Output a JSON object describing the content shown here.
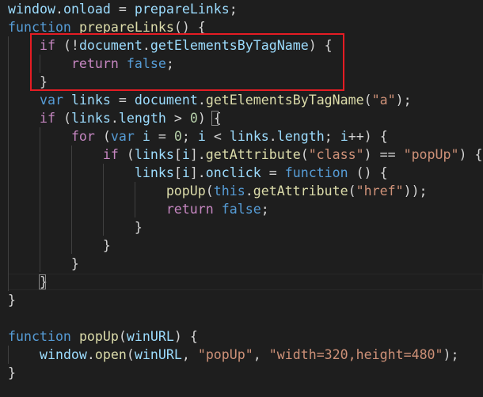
{
  "editor": {
    "highlight_color": "#e51c23",
    "theme": {
      "background": "#1e1e1e",
      "keyword": "#569cd6",
      "control": "#c586c0",
      "function": "#dcdcaa",
      "variable": "#9cdcfe",
      "string": "#ce9178",
      "number": "#b5cea8",
      "plain": "#d4d4d4"
    },
    "lines": [
      [
        [
          "var",
          "window"
        ],
        [
          "pl",
          "."
        ],
        [
          "var",
          "onload"
        ],
        [
          "pl",
          " = "
        ],
        [
          "var",
          "prepareLinks"
        ],
        [
          "pl",
          ";"
        ]
      ],
      [
        [
          "kw",
          "function"
        ],
        [
          "pl",
          " "
        ],
        [
          "fn",
          "prepareLinks"
        ],
        [
          "pl",
          "() {"
        ]
      ],
      [
        [
          "pl",
          "    "
        ],
        [
          "ctl",
          "if"
        ],
        [
          "pl",
          " (!"
        ],
        [
          "var",
          "document"
        ],
        [
          "pl",
          "."
        ],
        [
          "var",
          "getElementsByTagName"
        ],
        [
          "pl",
          ") {"
        ]
      ],
      [
        [
          "pl",
          "        "
        ],
        [
          "ctl",
          "return"
        ],
        [
          "pl",
          " "
        ],
        [
          "kw",
          "false"
        ],
        [
          "pl",
          ";"
        ]
      ],
      [
        [
          "pl",
          "    }"
        ]
      ],
      [
        [
          "pl",
          "    "
        ],
        [
          "kw",
          "var"
        ],
        [
          "pl",
          " "
        ],
        [
          "var",
          "links"
        ],
        [
          "pl",
          " = "
        ],
        [
          "var",
          "document"
        ],
        [
          "pl",
          "."
        ],
        [
          "fn",
          "getElementsByTagName"
        ],
        [
          "pl",
          "("
        ],
        [
          "str",
          "\"a\""
        ],
        [
          "pl",
          ");"
        ]
      ],
      [
        [
          "pl",
          "    "
        ],
        [
          "ctl",
          "if"
        ],
        [
          "pl",
          " ("
        ],
        [
          "var",
          "links"
        ],
        [
          "pl",
          "."
        ],
        [
          "var",
          "length"
        ],
        [
          "pl",
          " > "
        ],
        [
          "num",
          "0"
        ],
        [
          "pl",
          ") {"
        ]
      ],
      [
        [
          "pl",
          "        "
        ],
        [
          "ctl",
          "for"
        ],
        [
          "pl",
          " ("
        ],
        [
          "kw",
          "var"
        ],
        [
          "pl",
          " "
        ],
        [
          "var",
          "i"
        ],
        [
          "pl",
          " = "
        ],
        [
          "num",
          "0"
        ],
        [
          "pl",
          "; "
        ],
        [
          "var",
          "i"
        ],
        [
          "pl",
          " < "
        ],
        [
          "var",
          "links"
        ],
        [
          "pl",
          "."
        ],
        [
          "var",
          "length"
        ],
        [
          "pl",
          "; "
        ],
        [
          "var",
          "i"
        ],
        [
          "pl",
          "++) {"
        ]
      ],
      [
        [
          "pl",
          "            "
        ],
        [
          "ctl",
          "if"
        ],
        [
          "pl",
          " ("
        ],
        [
          "var",
          "links"
        ],
        [
          "pl",
          "["
        ],
        [
          "var",
          "i"
        ],
        [
          "pl",
          "]."
        ],
        [
          "fn",
          "getAttribute"
        ],
        [
          "pl",
          "("
        ],
        [
          "str",
          "\"class\""
        ],
        [
          "pl",
          ") == "
        ],
        [
          "str",
          "\"popUp\""
        ],
        [
          "pl",
          ") {"
        ]
      ],
      [
        [
          "pl",
          "                "
        ],
        [
          "var",
          "links"
        ],
        [
          "pl",
          "["
        ],
        [
          "var",
          "i"
        ],
        [
          "pl",
          "]."
        ],
        [
          "var",
          "onclick"
        ],
        [
          "pl",
          " = "
        ],
        [
          "kw",
          "function"
        ],
        [
          "pl",
          " () {"
        ]
      ],
      [
        [
          "pl",
          "                    "
        ],
        [
          "fn",
          "popUp"
        ],
        [
          "pl",
          "("
        ],
        [
          "kw",
          "this"
        ],
        [
          "pl",
          "."
        ],
        [
          "fn",
          "getAttribute"
        ],
        [
          "pl",
          "("
        ],
        [
          "str",
          "\"href\""
        ],
        [
          "pl",
          "));"
        ]
      ],
      [
        [
          "pl",
          "                    "
        ],
        [
          "ctl",
          "return"
        ],
        [
          "pl",
          " "
        ],
        [
          "kw",
          "false"
        ],
        [
          "pl",
          ";"
        ]
      ],
      [
        [
          "pl",
          "                }"
        ]
      ],
      [
        [
          "pl",
          "            }"
        ]
      ],
      [
        [
          "pl",
          "        }"
        ]
      ],
      [
        [
          "pl",
          "    }"
        ]
      ],
      [
        [
          "pl",
          "}"
        ]
      ],
      [],
      [
        [
          "kw",
          "function"
        ],
        [
          "pl",
          " "
        ],
        [
          "fn",
          "popUp"
        ],
        [
          "pl",
          "("
        ],
        [
          "var",
          "winURL"
        ],
        [
          "pl",
          ") {"
        ]
      ],
      [
        [
          "pl",
          "    "
        ],
        [
          "var",
          "window"
        ],
        [
          "pl",
          "."
        ],
        [
          "fn",
          "open"
        ],
        [
          "pl",
          "("
        ],
        [
          "var",
          "winURL"
        ],
        [
          "pl",
          ", "
        ],
        [
          "str",
          "\"popUp\""
        ],
        [
          "pl",
          ", "
        ],
        [
          "str",
          "\"width=320,height=480\""
        ],
        [
          "pl",
          ");"
        ]
      ],
      [
        [
          "pl",
          "}"
        ]
      ]
    ]
  }
}
